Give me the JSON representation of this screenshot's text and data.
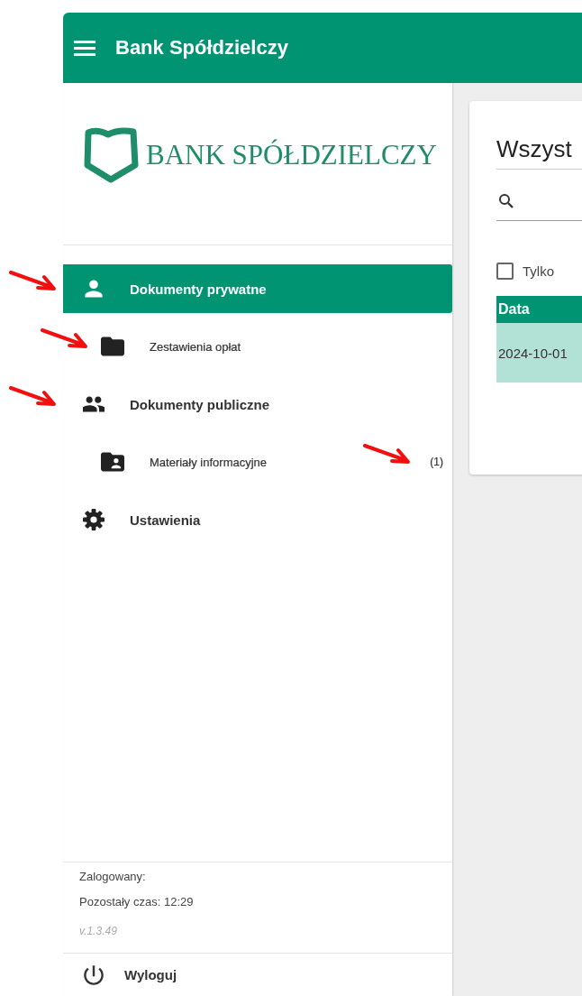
{
  "header": {
    "title": "Bank Spółdzielczy"
  },
  "logo": {
    "text": "BANK SPÓŁDZIELCZY"
  },
  "nav": [
    {
      "label": "Dokumenty prywatne",
      "kind": "main",
      "selected": true,
      "arrow_at_icon": true
    },
    {
      "label": "Zestawienia opłat",
      "kind": "sub",
      "selected": false,
      "arrow_at_icon": true
    },
    {
      "label": "Dokumenty publiczne",
      "kind": "main",
      "selected": false,
      "arrow_at_icon": true
    },
    {
      "label": "Materiały informacyjne",
      "kind": "sub",
      "selected": false,
      "count": "(1)",
      "arrow_at_count": true
    },
    {
      "label": "Ustawienia",
      "kind": "main",
      "selected": false
    }
  ],
  "footer": {
    "logged_in": "Zalogowany:",
    "remaining": "Pozostały czas: 12:29",
    "version": "v.1.3.49",
    "logout": "Wyloguj"
  },
  "card": {
    "title": "Wszyst",
    "filter": {
      "label": "Tylko",
      "checked": false
    },
    "table": {
      "columns": [
        "Data"
      ],
      "rows": [
        {
          "cells": [
            "2024-10-01"
          ],
          "selected": true
        }
      ]
    }
  }
}
